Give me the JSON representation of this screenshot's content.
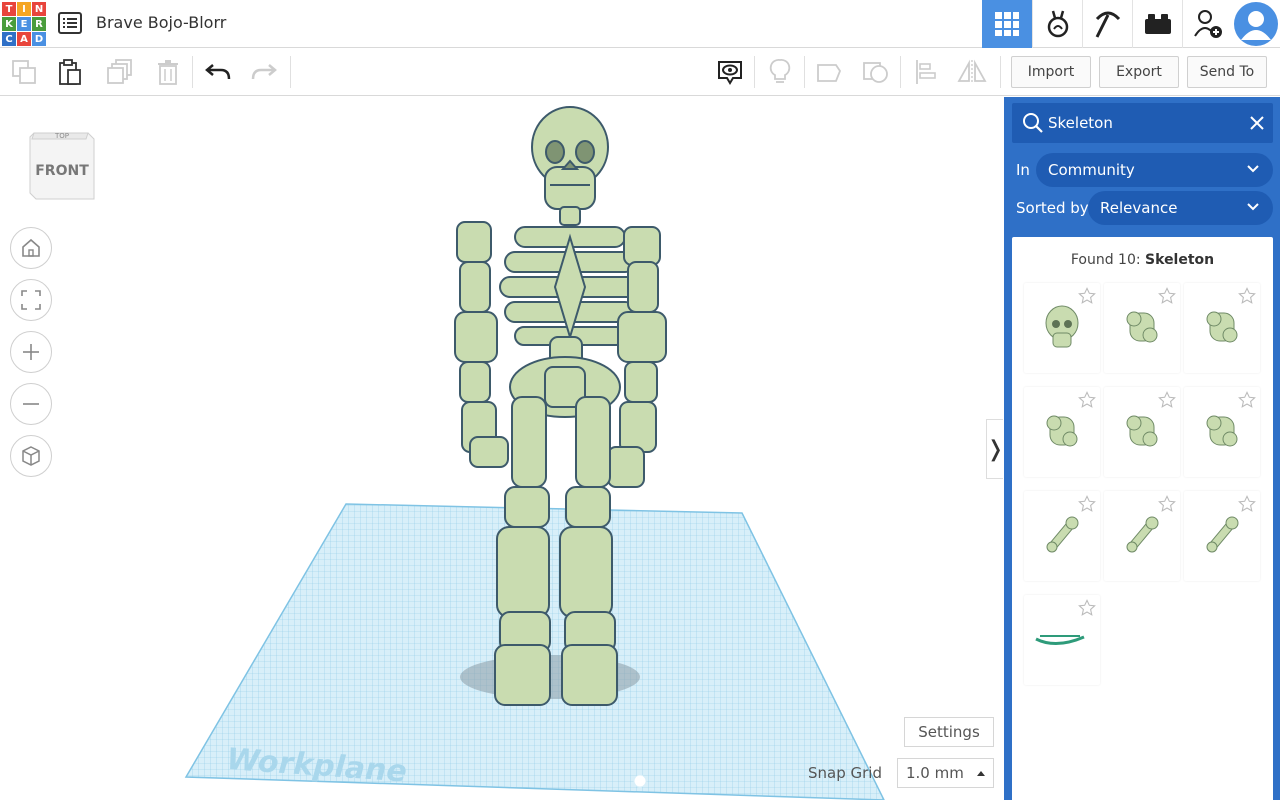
{
  "app": {
    "logo_letters": [
      "T",
      "I",
      "N",
      "K",
      "E",
      "R",
      "C",
      "A",
      "D"
    ],
    "logo_colors": [
      "#e8453c",
      "#f5a623",
      "#e8453c",
      "#4a9d3c",
      "#4a90e2",
      "#4a9d3c",
      "#2f70c7",
      "#e8453c",
      "#4a90e2"
    ],
    "design_title": "Brave Bojo-Blorr"
  },
  "topbar": {
    "buttons": [
      "3d-design-grid",
      "circuits",
      "codeblocks",
      "bricks",
      "invite-user"
    ],
    "active_color": "#4a90e2"
  },
  "toolbar": {
    "import_label": "Import",
    "export_label": "Export",
    "send_to_label": "Send To"
  },
  "canvas": {
    "viewcube_top": "TOP",
    "viewcube_front": "FRONT",
    "workplane_label": "Workplane",
    "settings_label": "Settings",
    "snap_grid_label": "Snap Grid",
    "snap_grid_value": "1.0 mm",
    "collapse_glyph": "❭",
    "shape_color": "#c9dcb0",
    "grid_color": "#a9d7ec"
  },
  "panel": {
    "search_query": "Skeleton",
    "in_label": "In",
    "in_value": "Community",
    "sorted_label": "Sorted by",
    "sorted_value": "Relevance",
    "found_prefix": "Found 10: ",
    "found_query": "Skeleton",
    "results": [
      "skull",
      "rib-part",
      "torso-part",
      "hand-part",
      "foot-part",
      "hand-part-2",
      "bone",
      "bone-2",
      "bone-3",
      "spine"
    ],
    "accent": "#2f70c7"
  }
}
